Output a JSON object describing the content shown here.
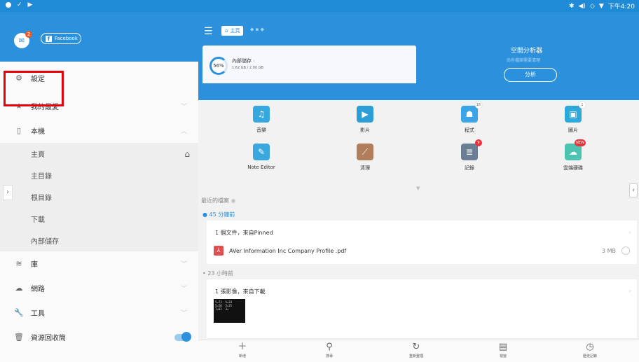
{
  "status_bar": {
    "time": "下午4:20",
    "left_icons": [
      "dot-icon",
      "check-icon",
      "play-icon"
    ],
    "right_icons": [
      "bluetooth-icon",
      "volume-icon",
      "data-icon",
      "wifi-icon"
    ]
  },
  "drawer": {
    "mail_badge": "2",
    "facebook_label": "Facebook",
    "items": [
      {
        "label": "設定",
        "icon": "gear-icon"
      },
      {
        "label": "我的最愛",
        "icon": "star-icon"
      },
      {
        "label": "本機",
        "icon": "phone-icon"
      }
    ],
    "local_subitems": [
      "主頁",
      "主目錄",
      "根目錄",
      "下載",
      "內部儲存"
    ],
    "more_items": [
      {
        "label": "庫",
        "icon": "library-icon"
      },
      {
        "label": "網路",
        "icon": "network-icon"
      },
      {
        "label": "工具",
        "icon": "wrench-icon"
      },
      {
        "label": "資源回收筒",
        "icon": "trash-icon"
      }
    ]
  },
  "main": {
    "breadcrumb_home": "主頁",
    "storage": {
      "percent": "56%",
      "title": "內部儲存",
      "size": "1.62 GB / 2.90 GB"
    },
    "analyzer": {
      "title": "空間分析器",
      "subtitle": "尚有檔案需要清理",
      "button": "分析"
    },
    "apps": [
      {
        "label": "音樂",
        "icon": "music-icon",
        "color": "#35a8e0"
      },
      {
        "label": "影片",
        "icon": "video-icon",
        "color": "#2b9ed8"
      },
      {
        "label": "程式",
        "icon": "android-icon",
        "color": "#3aa4e6",
        "badge": "18"
      },
      {
        "label": "圖片",
        "icon": "image-icon",
        "color": "#2ea8d8",
        "badge": "1"
      },
      {
        "label": "Note Editor",
        "icon": "note-icon",
        "color": "#3aa8df"
      },
      {
        "label": "清理",
        "icon": "broom-icon",
        "color": "#b07e5a"
      },
      {
        "label": "記錄",
        "icon": "stack-icon",
        "color": "#6a7f93",
        "badge": "9",
        "badge_red": true
      },
      {
        "label": "雲端硬碟",
        "icon": "cloud-icon",
        "color": "#4cc4b0",
        "badge": "NEW",
        "badge_red": true
      }
    ],
    "recent_title": "最近的檔案",
    "groups": [
      {
        "time": "45 分鐘前",
        "card_title": "1 個文件，來自Pinned",
        "file_name": "AVer Information Inc  Company Profile .pdf",
        "file_size": "3 MB"
      },
      {
        "time": "23 小時前",
        "card_title": "1 張影像，來自下載"
      }
    ],
    "toolbar": [
      {
        "label": "新增",
        "icon": "plus-icon"
      },
      {
        "label": "搜尋",
        "icon": "search-icon"
      },
      {
        "label": "重新整理",
        "icon": "refresh-icon"
      },
      {
        "label": "視窗",
        "icon": "windows-icon"
      },
      {
        "label": "歷史記錄",
        "icon": "history-icon"
      }
    ]
  }
}
